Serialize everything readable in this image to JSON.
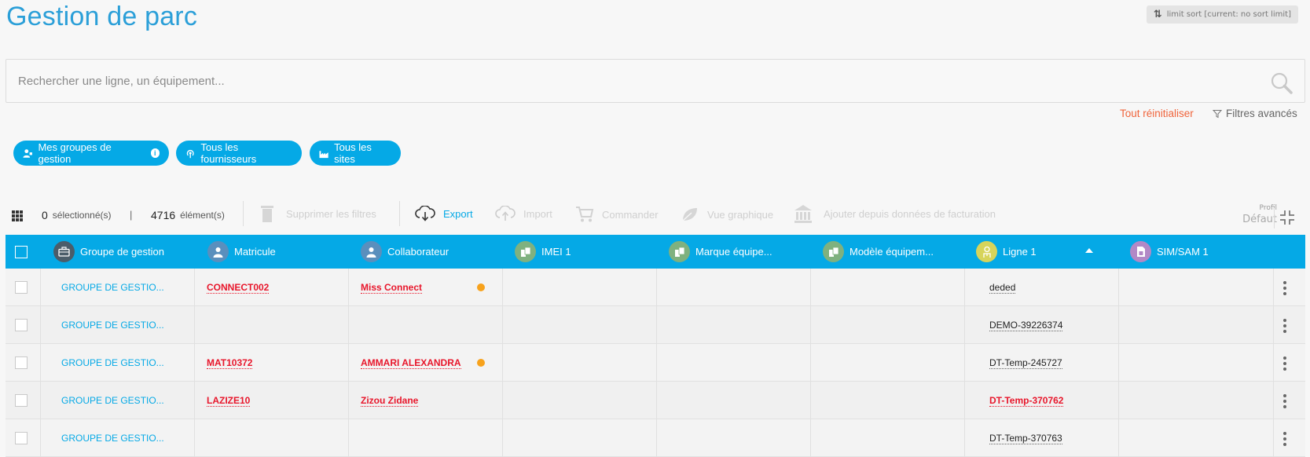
{
  "page": {
    "title": "Gestion de parc"
  },
  "limit_badge": {
    "label": "limit sort [current: no sort limit]"
  },
  "search": {
    "placeholder": "Rechercher une ligne, un équipement..."
  },
  "filters": {
    "reset_label": "Tout réinitialiser",
    "advanced_label": "Filtres avancés"
  },
  "chips": [
    {
      "label": "Mes groupes de gestion"
    },
    {
      "label": "Tous les fournisseurs"
    },
    {
      "label": "Tous les sites"
    }
  ],
  "toolbar": {
    "selected_count": "0",
    "selected_label": "sélectionné(s)",
    "separator": "|",
    "element_count": "4716",
    "element_label": "élément(s)",
    "remove_filters": "Supprimer les filtres",
    "export": "Export",
    "import": "Import",
    "order": "Commander",
    "graph_view": "Vue graphique",
    "add_billing": "Ajouter depuis données de facturation",
    "profil_label": "Profil",
    "profil_value": "Défaut"
  },
  "colors": {
    "accent": "#05a9e6",
    "header_bg": "#05a9e6",
    "link_red": "#e8162b",
    "reset_orange": "#f0643b",
    "status_dot": "#f7a21c"
  },
  "table": {
    "columns": [
      {
        "label": "Groupe de gestion",
        "icon": "briefcase-icon",
        "icon_bg": "#4b5d6a"
      },
      {
        "label": "Matricule",
        "icon": "user-icon",
        "icon_bg": "#5a8fbd"
      },
      {
        "label": "Collaborateur",
        "icon": "user-icon",
        "icon_bg": "#5a8fbd"
      },
      {
        "label": "IMEI 1",
        "icon": "device-icon",
        "icon_bg": "#7fb17f"
      },
      {
        "label": "Marque équipe...",
        "icon": "device-icon",
        "icon_bg": "#7fb17f"
      },
      {
        "label": "Modèle équipem...",
        "icon": "device-icon",
        "icon_bg": "#7fb17f"
      },
      {
        "label": "Ligne 1",
        "icon": "line-icon",
        "icon_bg": "#d7d45a"
      },
      {
        "label": "SIM/SAM 1",
        "icon": "sim-icon",
        "icon_bg": "#b289c6"
      }
    ],
    "rows": [
      {
        "group": "GROUPE DE GESTIO...",
        "matricule": "CONNECT002",
        "collaborateur": "Miss Connect",
        "status_dot": true,
        "ligne": "deded",
        "ligne_style": "black"
      },
      {
        "group": "GROUPE DE GESTIO...",
        "matricule": "",
        "collaborateur": "",
        "status_dot": false,
        "ligne": "DEMO-39226374",
        "ligne_style": "black"
      },
      {
        "group": "GROUPE DE GESTIO...",
        "matricule": "MAT10372",
        "collaborateur": "AMMARI ALEXANDRA",
        "status_dot": true,
        "ligne": "DT-Temp-245727",
        "ligne_style": "black"
      },
      {
        "group": "GROUPE DE GESTIO...",
        "matricule": "LAZIZE10",
        "collaborateur": "Zizou Zidane",
        "status_dot": false,
        "ligne": "DT-Temp-370762",
        "ligne_style": "red"
      },
      {
        "group": "GROUPE DE GESTIO...",
        "matricule": "",
        "collaborateur": "",
        "status_dot": false,
        "ligne": "DT-Temp-370763",
        "ligne_style": "black"
      }
    ]
  }
}
